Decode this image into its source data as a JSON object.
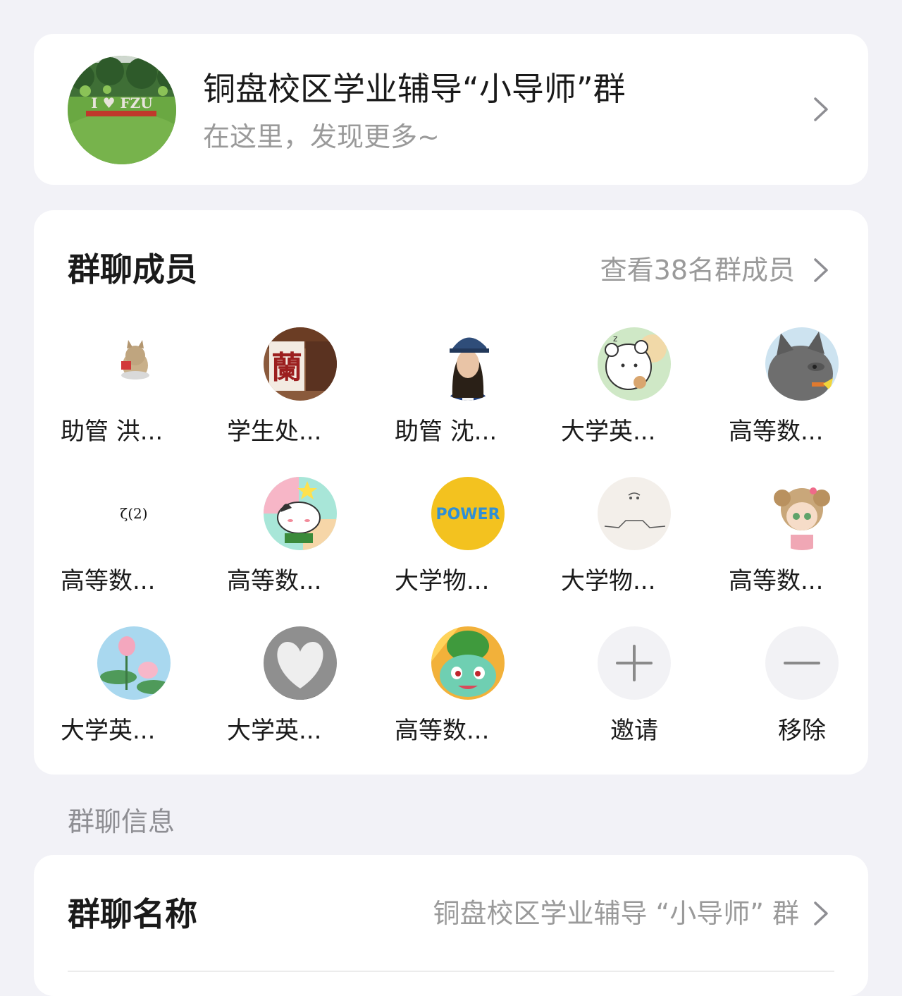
{
  "group": {
    "title": "铜盘校区学业辅导“小导师”群",
    "subtitle": "在这里，发现更多~",
    "avatar_sign_text": "I ♥ FZU"
  },
  "members_section": {
    "title": "群聊成员",
    "view_all": "查看38名群成员",
    "members": [
      {
        "name": "助管 洪...",
        "avatar": "cat-sticker"
      },
      {
        "name": "学生处...",
        "avatar": "lan-character-icon"
      },
      {
        "name": "助管 沈...",
        "avatar": "girl-with-cap"
      },
      {
        "name": "大学英...",
        "avatar": "bear-cartoon"
      },
      {
        "name": "高等数...",
        "avatar": "gray-wolf-cartoon"
      },
      {
        "name": "高等数...",
        "avatar": "zeta-text",
        "avatar_text": "ζ(2)"
      },
      {
        "name": "高等数...",
        "avatar": "cat-star-cartoon"
      },
      {
        "name": "大学物...",
        "avatar": "power-text-logo",
        "avatar_text": "POWER"
      },
      {
        "name": "大学物...",
        "avatar": "line-sketch"
      },
      {
        "name": "高等数...",
        "avatar": "anime-girl"
      },
      {
        "name": "大学英...",
        "avatar": "lotus-flowers"
      },
      {
        "name": "大学英...",
        "avatar": "heart-hands"
      },
      {
        "name": "高等数...",
        "avatar": "bulbasaur"
      }
    ],
    "actions": {
      "invite": "邀请",
      "remove": "移除"
    }
  },
  "info_section": {
    "label": "群聊信息",
    "name_label": "群聊名称",
    "name_value": "铜盘校区学业辅导 “小导师” 群"
  },
  "colors": {
    "background": "#f2f2f7",
    "card": "#ffffff",
    "secondary_text": "#9a9a9a",
    "action_circle": "#f2f2f5"
  }
}
